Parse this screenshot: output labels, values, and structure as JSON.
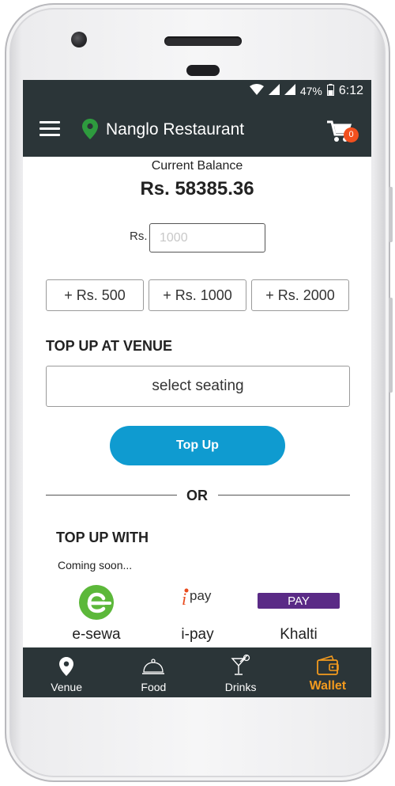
{
  "status_bar": {
    "battery": "47%",
    "time": "6:12"
  },
  "header": {
    "venue_name": "Nanglo Restaurant",
    "cart_count": "0"
  },
  "wallet": {
    "balance_label": "Current Balance",
    "balance_value": "Rs. 58385.36",
    "amount_prefix": "Rs.",
    "amount_placeholder": "1000",
    "quick_amounts": [
      "+ Rs. 500",
      "+ Rs. 1000",
      "+ Rs. 2000"
    ]
  },
  "venue_topup": {
    "title": "TOP UP AT VENUE",
    "seating_label": "select seating",
    "topup_button": "Top Up"
  },
  "divider_text": "OR",
  "online_topup": {
    "title": "TOP UP WITH",
    "note": "Coming soon...",
    "methods": [
      {
        "label": "e-sewa",
        "icon": "esewa-logo"
      },
      {
        "label": "i-pay",
        "icon": "ipay-logo",
        "logo_text": "pay"
      },
      {
        "label": "Khalti",
        "icon": "khalti-logo",
        "logo_text": "PAY"
      }
    ]
  },
  "bottom_nav": {
    "items": [
      {
        "label": "Venue",
        "icon": "location-pin-icon"
      },
      {
        "label": "Food",
        "icon": "cloche-icon"
      },
      {
        "label": "Drinks",
        "icon": "cocktail-icon"
      },
      {
        "label": "Wallet",
        "icon": "wallet-icon",
        "active": true
      }
    ]
  },
  "colors": {
    "appbar": "#2b3538",
    "accent_blue": "#0f9bd0",
    "active_orange": "#f39a1e",
    "badge": "#f2501e",
    "pin_green": "#2e9b3e",
    "esewa_green": "#5cb83a",
    "khalti_purple": "#5a2a86"
  }
}
